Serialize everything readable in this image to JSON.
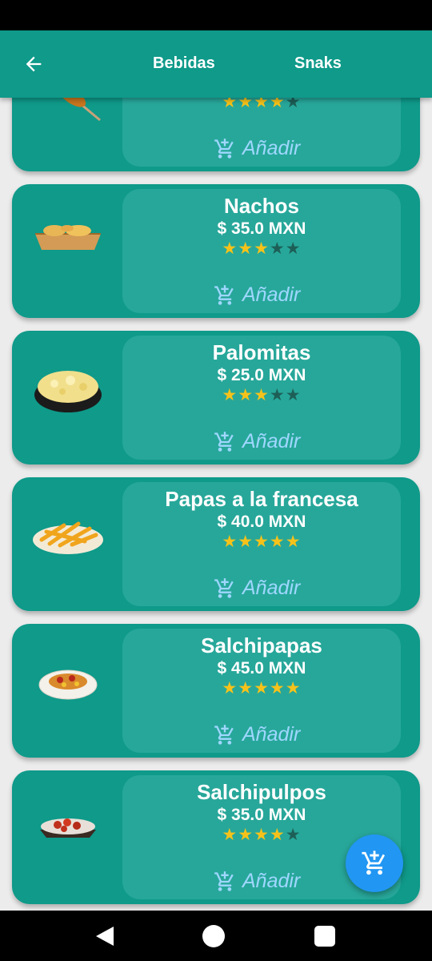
{
  "header": {
    "tabs": [
      "Bebidas",
      "Snaks"
    ]
  },
  "add_label": "Añadir",
  "colors": {
    "primary": "#0f9a8a",
    "card_inner": "#27a79a",
    "star_on": "#f6c21a",
    "star_off": "#1d5f57",
    "add_text": "#9fd7ff",
    "fab": "#2196f3"
  },
  "items": [
    {
      "name": "",
      "price": "",
      "rating": 4,
      "image": "corn-dog-image"
    },
    {
      "name": "Nachos",
      "price": "$ 35.0 MXN",
      "rating": 3,
      "image": "nachos-image"
    },
    {
      "name": "Palomitas",
      "price": "$ 25.0 MXN",
      "rating": 3,
      "image": "popcorn-image"
    },
    {
      "name": "Papas a la francesa",
      "price": "$ 40.0 MXN",
      "rating": 5,
      "image": "fries-image"
    },
    {
      "name": "Salchipapas",
      "price": "$ 45.0 MXN",
      "rating": 5,
      "image": "salchipapas-image"
    },
    {
      "name": "Salchipulpos",
      "price": "$ 35.0 MXN",
      "rating": 4,
      "image": "salchipulpos-image"
    }
  ]
}
